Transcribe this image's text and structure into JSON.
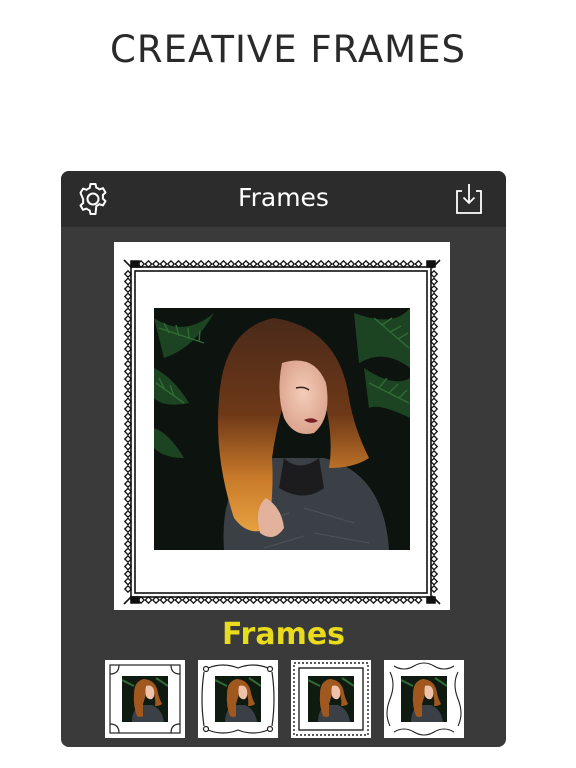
{
  "headline": "CREATIVE FRAMES",
  "navbar": {
    "title": "Frames",
    "settings_icon": "gear-icon",
    "download_icon": "download-icon"
  },
  "section_label": "Frames",
  "thumbnails": [
    {
      "style": "corner-ornament"
    },
    {
      "style": "scroll-ornament"
    },
    {
      "style": "dotted-border"
    },
    {
      "style": "swirl-ornament"
    }
  ],
  "colors": {
    "panel": "#3a3a3a",
    "navbar": "#2c2c2c",
    "accent": "#e8dc1d"
  }
}
